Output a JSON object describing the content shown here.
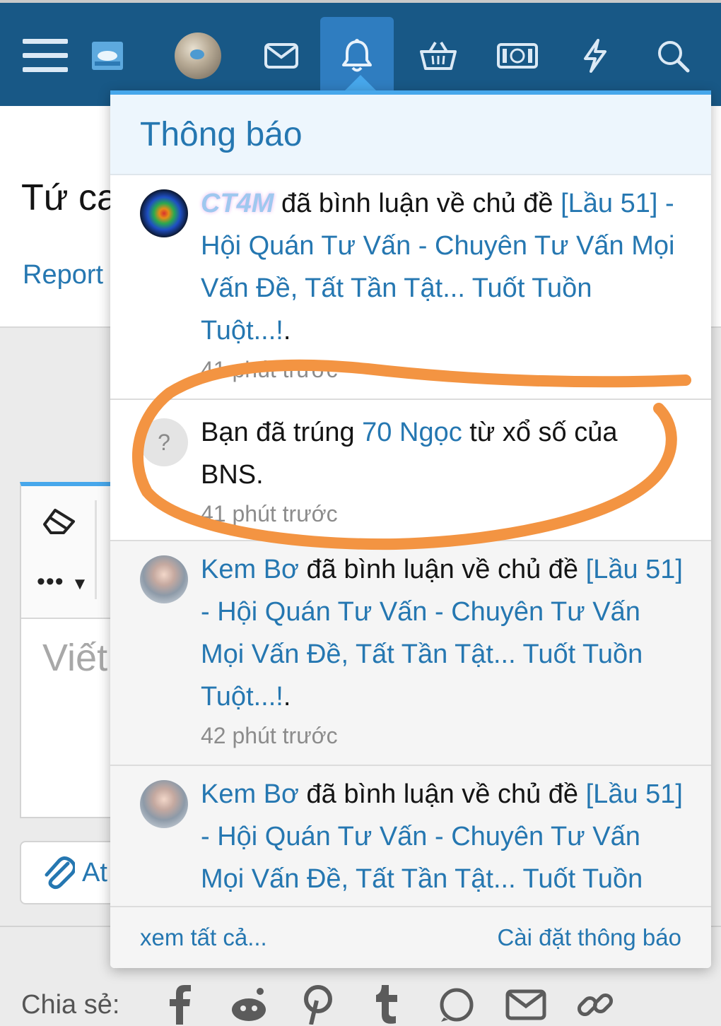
{
  "page": {
    "title_partial": "Tứ ca",
    "report_label": "Report",
    "editor_placeholder": "Viết",
    "editor_more_label": "•••",
    "attach_label_partial": "At",
    "share_label": "Chia sẻ:",
    "share_icons": [
      "facebook-icon",
      "reddit-icon",
      "pinterest-icon",
      "tumblr-icon",
      "whatsapp-icon",
      "email-icon",
      "link-icon"
    ]
  },
  "nav": {
    "items": [
      "menu-icon",
      "logo-icon",
      "avatar",
      "inbox-icon",
      "bell-icon",
      "basket-icon",
      "money-icon",
      "lightning-icon",
      "search-icon"
    ],
    "active": "bell-icon"
  },
  "popup": {
    "title": "Thông báo",
    "notifications": [
      {
        "user": "CT4M",
        "action": " đã bình luận về chủ đề ",
        "thread": "[Lầu 51] - Hội Quán Tư Vấn - Chuyên Tư Vấn Mọi Vấn Đề, Tất Tần Tật... Tuốt Tuồn Tuột...!",
        "end": ".",
        "time": "41 phút trước"
      },
      {
        "avatar_text": "?",
        "pre": "Bạn đã trúng ",
        "link": "70 Ngọc",
        "post": " từ xổ số của BNS.",
        "time": "41 phút trước"
      },
      {
        "user": "Kem Bơ",
        "action": " đã bình luận về chủ đề ",
        "thread": "[Lầu 51] - Hội Quán Tư Vấn - Chuyên Tư Vấn Mọi Vấn Đề, Tất Tần Tật... Tuốt Tuồn Tuột...!",
        "end": ".",
        "time": "42 phút trước"
      },
      {
        "user": "Kem Bơ",
        "action": " đã bình luận về chủ đề ",
        "thread": "[Lầu 51] - Hội Quán Tư Vấn - Chuyên Tư Vấn Mọi Vấn Đề, Tất Tần Tật... Tuốt Tuồn",
        "end": "",
        "time": ""
      }
    ],
    "footer": {
      "view_all": "xem tất cả...",
      "settings": "Cài đặt thông báo"
    }
  },
  "colors": {
    "nav_bg": "#185886",
    "nav_active": "#2f7dc0",
    "accent": "#47a7eb",
    "link": "#2577b1",
    "annotation": "#f39442"
  }
}
